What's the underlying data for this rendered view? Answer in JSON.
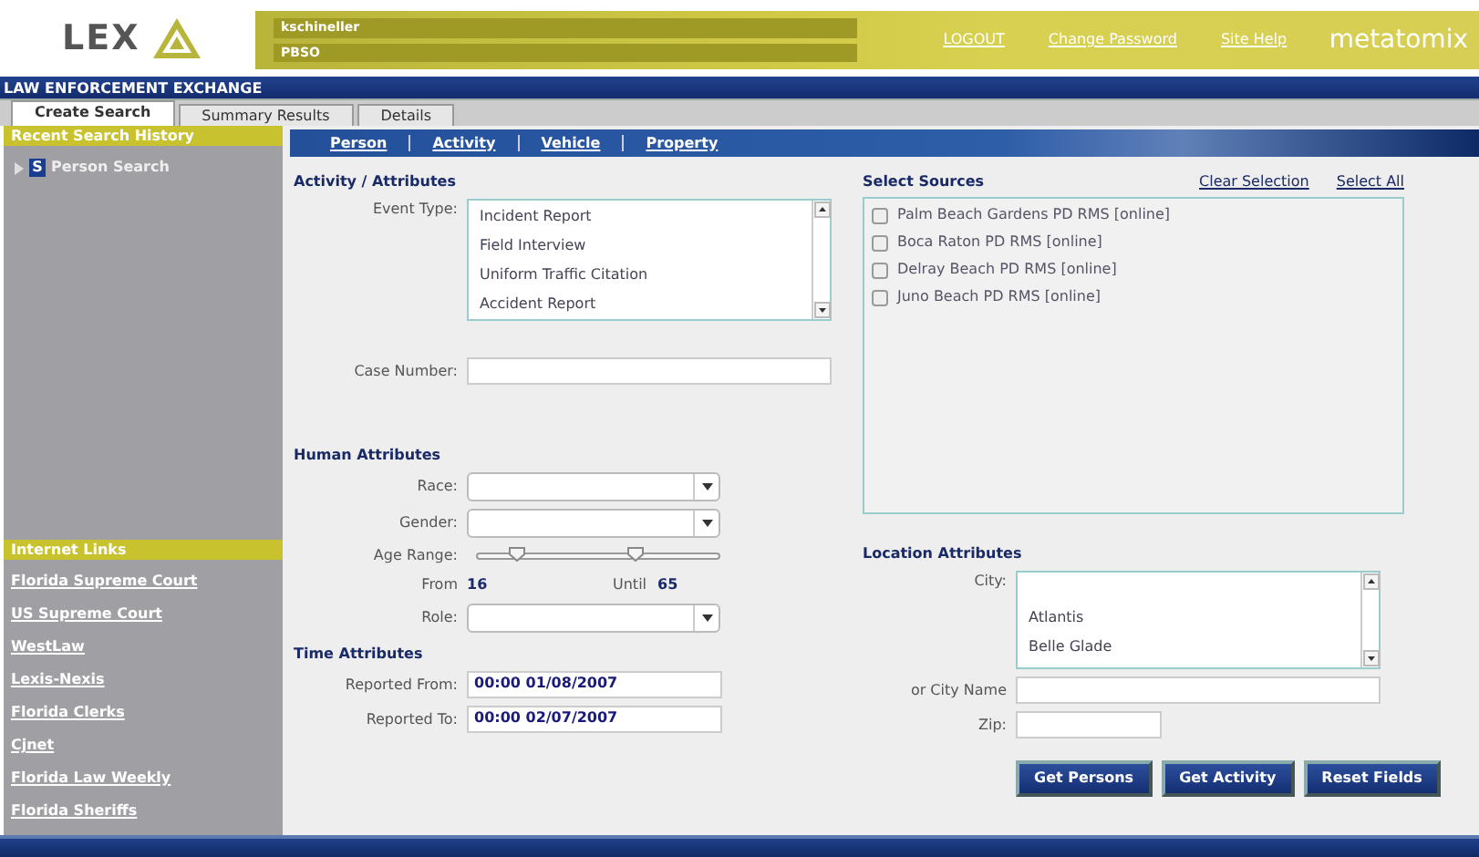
{
  "header": {
    "logo": "LEX",
    "user": "kschineller",
    "agency": "PBSO",
    "links": [
      "LOGOUT",
      "Change Password",
      "Site Help"
    ],
    "brand": "metatomix"
  },
  "app_bar": {
    "title": "LAW ENFORCEMENT EXCHANGE"
  },
  "tabs": [
    {
      "label": "Create Search",
      "selected": true
    },
    {
      "label": "Summary Results",
      "selected": false
    },
    {
      "label": "Details",
      "selected": false
    }
  ],
  "sidebar": {
    "history_title": "Recent Search History",
    "history": [
      {
        "badge": "S",
        "label": "Person Search"
      }
    ],
    "links_title": "Internet Links",
    "links": [
      "Florida Supreme Court",
      "US Supreme Court",
      "WestLaw",
      "Lexis-Nexis",
      "Florida Clerks",
      "Cjnet",
      "Florida Law Weekly",
      "Florida Sheriffs"
    ]
  },
  "subnav": [
    "Person",
    "Activity",
    "Vehicle",
    "Property"
  ],
  "activity": {
    "title": "Activity / Attributes",
    "event_type_label": "Event Type:",
    "event_types": [
      "Incident Report",
      "Field Interview",
      "Uniform Traffic Citation",
      "Accident Report"
    ],
    "case_number_label": "Case Number:"
  },
  "human": {
    "title": "Human Attributes",
    "race_label": "Race:",
    "gender_label": "Gender:",
    "age_label": "Age Range:",
    "age_thumbs": [
      {
        "level": 0.16
      },
      {
        "level": 0.65
      }
    ],
    "from_label": "From",
    "from": "16",
    "until_label": "Until",
    "until": "65",
    "role_label": "Role:"
  },
  "time": {
    "title": "Time Attributes",
    "from_label": "Reported From:",
    "from": "00:00 01/08/2007",
    "to_label": "Reported To:",
    "to": "00:00 02/07/2007"
  },
  "sources": {
    "title": "Select Sources",
    "actions": [
      "Clear Selection",
      "Select All"
    ],
    "items": [
      {
        "label": "Palm Beach Gardens PD RMS [online]",
        "checked": false
      },
      {
        "label": "Boca Raton PD RMS [online]",
        "checked": false
      },
      {
        "label": "Delray Beach PD RMS [online]",
        "checked": false
      },
      {
        "label": "Juno Beach PD RMS [online]",
        "checked": false
      }
    ]
  },
  "location": {
    "title": "Location Attributes",
    "city_label": "City:",
    "cities": [
      "Atlantis",
      "Belle Glade"
    ],
    "city_name_label": "or City Name",
    "zip_label": "Zip:"
  },
  "buttons": [
    "Get Persons",
    "Get Activity",
    "Reset Fields"
  ]
}
